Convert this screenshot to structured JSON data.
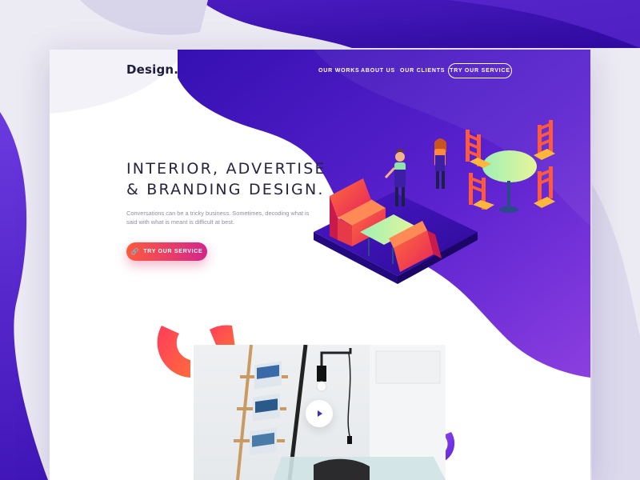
{
  "header": {
    "logo": "Design.",
    "nav": [
      {
        "label": "OUR WORKS"
      },
      {
        "label": "ABOUT US"
      },
      {
        "label": "OUR CLIENTS"
      }
    ],
    "cta_label": "TRY OUR SERVICE"
  },
  "hero": {
    "title_line1": "INTERIOR, ADVERTISE",
    "title_line2": "& BRANDING DESIGN.",
    "description": "Conversations can be a tricky business. Sometimes, decoding what is said with what is meant is difficult at best.",
    "button_label": "TRY OUR SERVICE",
    "button_icon": "link-icon"
  },
  "media": {
    "play_icon": "play-icon"
  },
  "colors": {
    "purple_dark": "#3a0fb0",
    "purple": "#6a2fd6",
    "button_start": "#ff5a3d",
    "button_end": "#d2268c"
  }
}
